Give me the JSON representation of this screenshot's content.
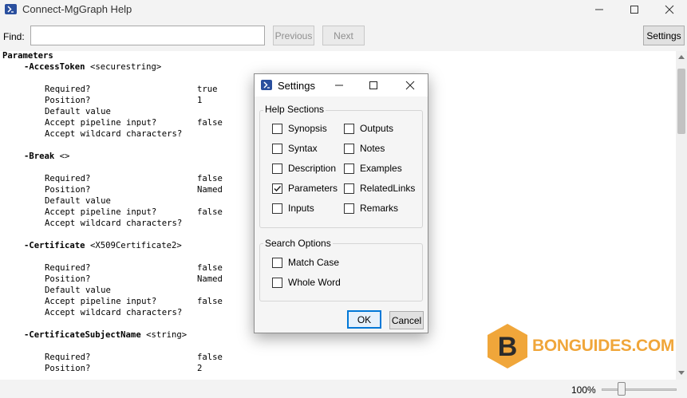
{
  "window": {
    "title": "Connect-MgGraph Help"
  },
  "findbar": {
    "label": "Find:",
    "value": "",
    "placeholder": "",
    "previous_label": "Previous",
    "next_label": "Next",
    "settings_label": "Settings"
  },
  "content": {
    "heading": "Parameters",
    "parameters": [
      {
        "name": "-AccessToken",
        "type": "<securestring>",
        "rows": [
          [
            "Required?",
            "true"
          ],
          [
            "Position?",
            "1"
          ],
          [
            "Default value",
            ""
          ],
          [
            "Accept pipeline input?",
            "false"
          ],
          [
            "Accept wildcard characters?",
            ""
          ]
        ]
      },
      {
        "name": "-Break",
        "type": "<>",
        "rows": [
          [
            "Required?",
            "false"
          ],
          [
            "Position?",
            "Named"
          ],
          [
            "Default value",
            ""
          ],
          [
            "Accept pipeline input?",
            "false"
          ],
          [
            "Accept wildcard characters?",
            ""
          ]
        ]
      },
      {
        "name": "-Certificate",
        "type": "<X509Certificate2>",
        "rows": [
          [
            "Required?",
            "false"
          ],
          [
            "Position?",
            "Named"
          ],
          [
            "Default value",
            ""
          ],
          [
            "Accept pipeline input?",
            "false"
          ],
          [
            "Accept wildcard characters?",
            ""
          ]
        ]
      },
      {
        "name": "-CertificateSubjectName",
        "type": "<string>",
        "rows": [
          [
            "Required?",
            "false"
          ],
          [
            "Position?",
            "2"
          ]
        ]
      }
    ]
  },
  "statusbar": {
    "zoom": "100%",
    "zoom_slider_fraction": 0.27
  },
  "watermark": {
    "letter": "B",
    "text": "BONGUIDES.COM",
    "color": "#f0a63a"
  },
  "dialog": {
    "title": "Settings",
    "help_sections_label": "Help Sections",
    "help_sections": [
      {
        "label": "Synopsis",
        "checked": false
      },
      {
        "label": "Outputs",
        "checked": false
      },
      {
        "label": "Syntax",
        "checked": false
      },
      {
        "label": "Notes",
        "checked": false
      },
      {
        "label": "Description",
        "checked": false
      },
      {
        "label": "Examples",
        "checked": false
      },
      {
        "label": "Parameters",
        "checked": true
      },
      {
        "label": "RelatedLinks",
        "checked": false
      },
      {
        "label": "Inputs",
        "checked": false
      },
      {
        "label": "Remarks",
        "checked": false
      }
    ],
    "search_options_label": "Search Options",
    "search_options": [
      {
        "label": "Match Case",
        "checked": false
      },
      {
        "label": "Whole Word",
        "checked": false
      }
    ],
    "ok_label": "OK",
    "cancel_label": "Cancel"
  },
  "colors": {
    "accent": "#0078d7",
    "app_icon": "#2a4f9e"
  }
}
